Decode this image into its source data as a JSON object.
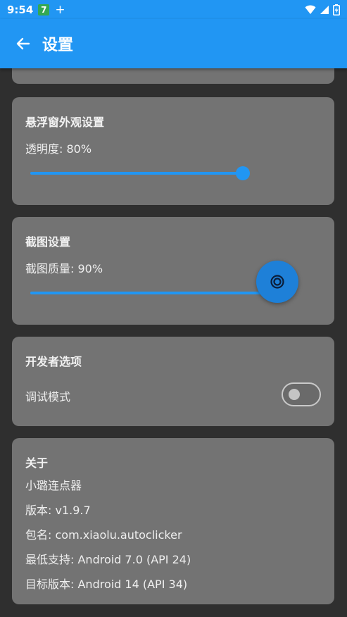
{
  "status_bar": {
    "time": "9:54",
    "badge": "7",
    "plus": "+",
    "icons": [
      "wifi-icon",
      "signal-icon",
      "battery-icon"
    ]
  },
  "app_bar": {
    "title": "设置",
    "back_icon": "arrow-back-icon"
  },
  "float_window": {
    "title": "悬浮窗外观设置",
    "opacity_label": "透明度: 80%",
    "opacity_value": 0.8
  },
  "screenshot": {
    "title": "截图设置",
    "quality_label": "截图质量: 90%",
    "quality_value": 0.9
  },
  "developer": {
    "title": "开发者选项",
    "debug_label": "调试模式",
    "debug_enabled": false
  },
  "about": {
    "title": "关于",
    "app_name": "小璐连点器",
    "version": "版本: v1.9.7",
    "package": "包名: com.xiaolu.autoclicker",
    "min_sdk": "最低支持: Android 7.0 (API 24)",
    "target_sdk": "目标版本: Android 14 (API 34)"
  },
  "colors": {
    "accent": "#2196f3",
    "card": "#737373",
    "background": "#2f2f2f"
  }
}
